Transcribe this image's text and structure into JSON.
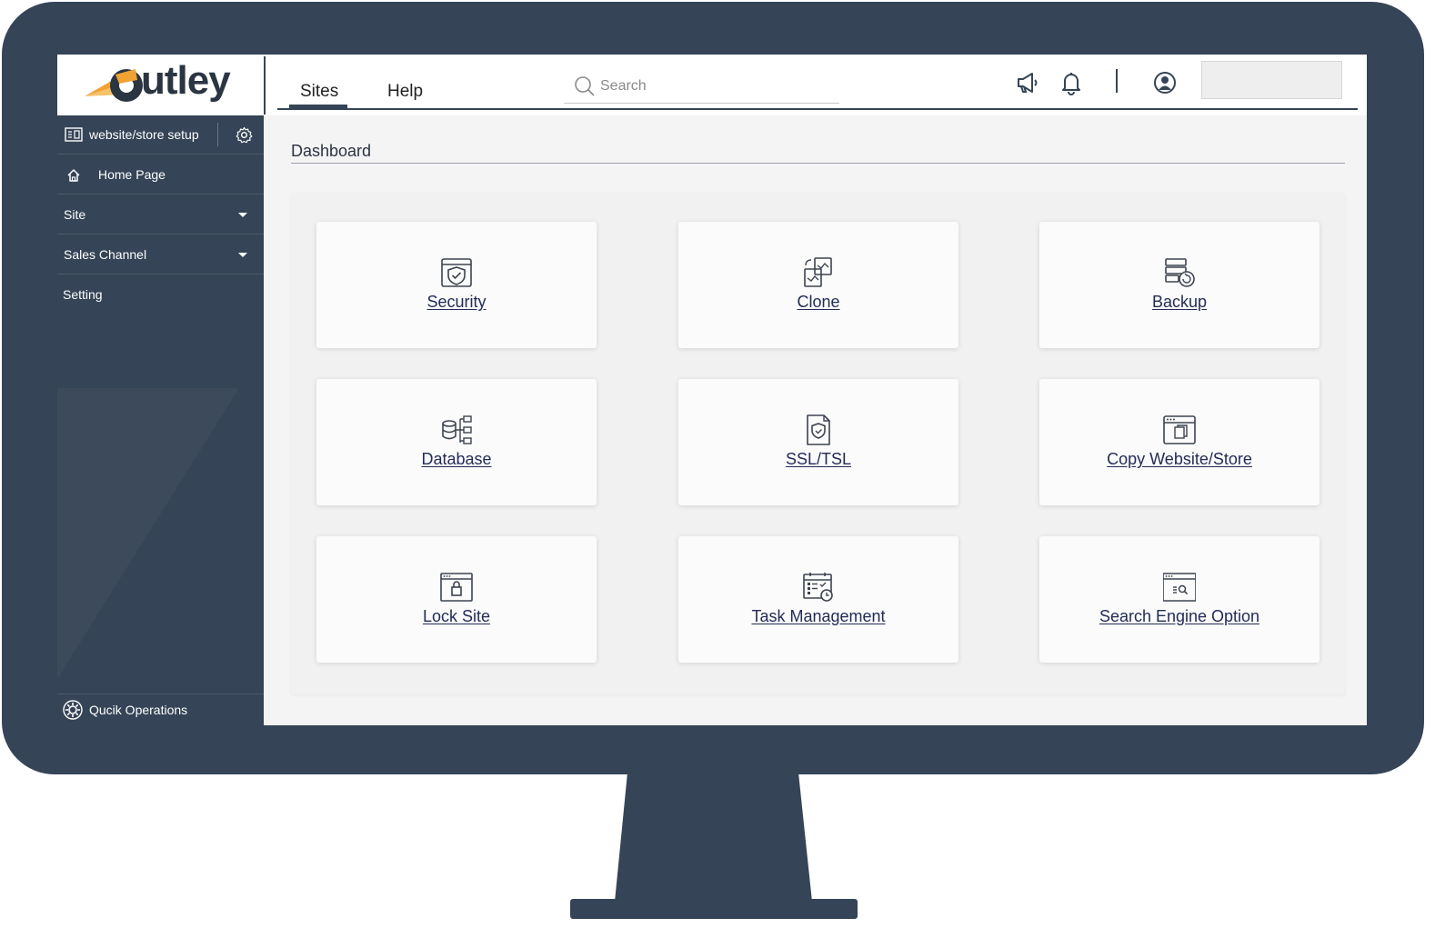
{
  "brand": {
    "logo_text": "utley"
  },
  "header": {
    "tabs": [
      {
        "label": "Sites",
        "active": true
      },
      {
        "label": "Help",
        "active": false
      }
    ],
    "search": {
      "placeholder": "Search",
      "value": ""
    },
    "icons": [
      "megaphone-icon",
      "bell-icon",
      "user-circle-icon"
    ]
  },
  "sidebar": {
    "setup": {
      "label": "website/store setup",
      "icon": "layout-icon",
      "action_icon": "gear-icon"
    },
    "items": [
      {
        "label": "Home Page",
        "icon": "home-icon"
      },
      {
        "label": "Site",
        "dropdown": true
      },
      {
        "label": "Sales Channel",
        "dropdown": true
      },
      {
        "label": "Setting"
      }
    ],
    "footer": {
      "label": "Qucik Operations",
      "icon": "gear-icon"
    }
  },
  "main": {
    "title": "Dashboard",
    "cards": [
      {
        "label": "Security",
        "icon": "security-shield-icon"
      },
      {
        "label": "Clone",
        "icon": "clone-icon"
      },
      {
        "label": "Backup",
        "icon": "backup-icon"
      },
      {
        "label": "Database",
        "icon": "database-icon"
      },
      {
        "label": "SSL/TSL",
        "icon": "ssl-certificate-icon"
      },
      {
        "label": "Copy Website/Store",
        "icon": "copy-window-icon"
      },
      {
        "label": "Lock Site",
        "icon": "lock-window-icon"
      },
      {
        "label": "Task Management",
        "icon": "task-calendar-icon"
      },
      {
        "label": "Search Engine Option",
        "icon": "search-window-icon"
      }
    ]
  },
  "colors": {
    "frame": "#354456",
    "accent_orange": "#f0a233",
    "link": "#232c57",
    "content_bg": "#f4f4f5"
  }
}
